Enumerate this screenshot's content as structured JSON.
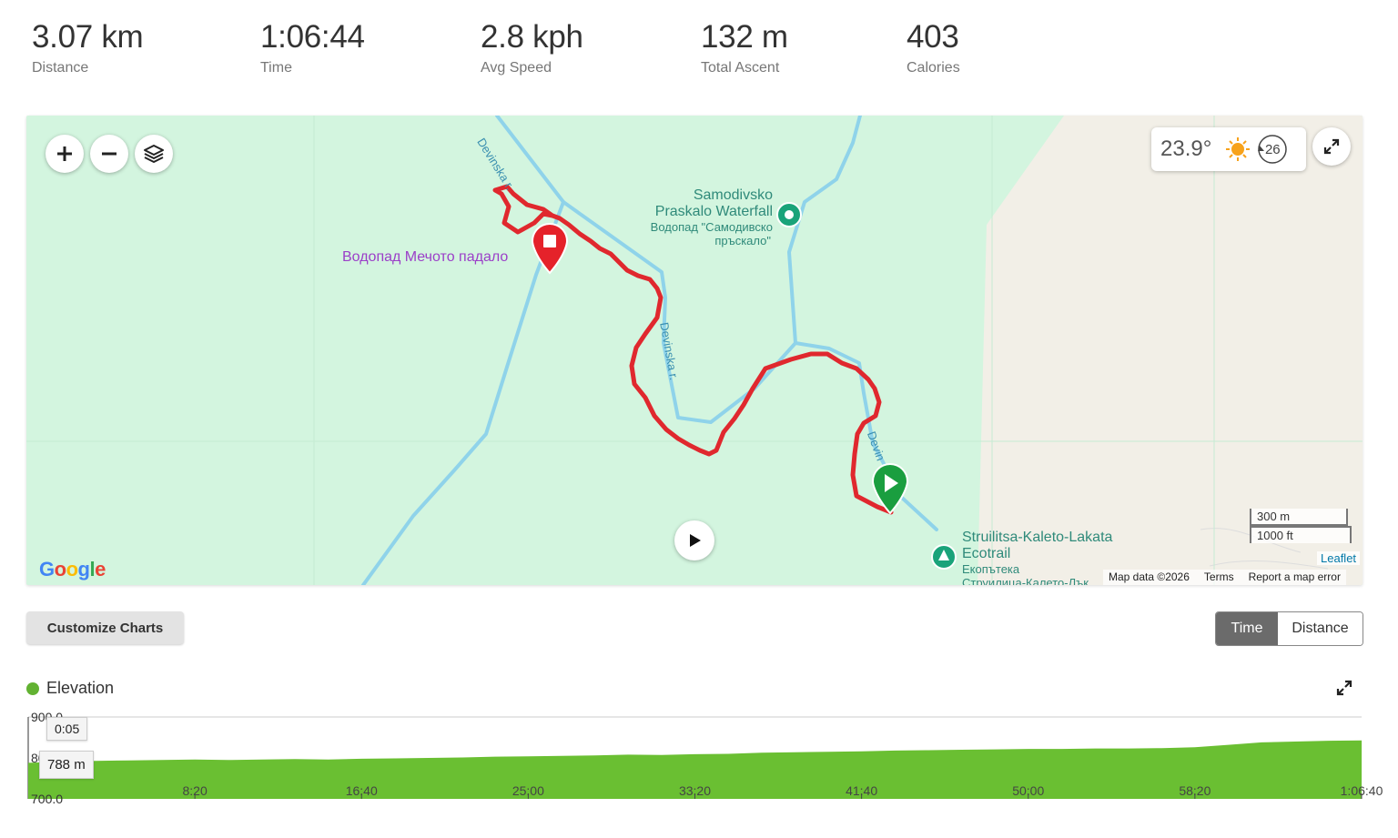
{
  "stats": [
    {
      "value": "3.07 km",
      "label": "Distance"
    },
    {
      "value": "1:06:44",
      "label": "Time"
    },
    {
      "value": "2.8 kph",
      "label": "Avg Speed"
    },
    {
      "value": "132 m",
      "label": "Total Ascent"
    },
    {
      "value": "403",
      "label": "Calories"
    }
  ],
  "map": {
    "weather": {
      "temperature": "23.9°",
      "icon": "sun-icon",
      "wind_speed": "26",
      "wind_icon": "wind-direction-icon"
    },
    "labels": {
      "river_1": "Devinska r.",
      "river_2": "Devinska r.",
      "river_3": "Devin",
      "waterfall_name_1": "Samodivsko",
      "waterfall_name_2": "Praskalo Waterfall",
      "waterfall_local_1": "Водопад \"Самодивско",
      "waterfall_local_2": "пръскало\"",
      "end_poi": "Водопад Мечото падало",
      "trail_name_1": "Struilitsa-Kaleto-Lakata",
      "trail_name_2": "Ecotrail",
      "trail_local_1": "Екопътека",
      "trail_local_2": "Струилица-Калето-Лък"
    },
    "scale": {
      "metric": "300 m",
      "imperial": "1000 ft"
    },
    "attribution": {
      "leaflet": "Leaflet",
      "map_data": "Map data ©2026",
      "terms": "Terms",
      "report": "Report a map error"
    },
    "google": "Google",
    "colors": {
      "route": "#e0282e",
      "start": "#1a9e3f",
      "end": "#e5222a",
      "water": "#8fd3ea",
      "land": "#d3f5df",
      "terrain": "#f2efe7"
    }
  },
  "controls": {
    "customize": "Customize Charts",
    "toggle": {
      "time": "Time",
      "distance": "Distance"
    }
  },
  "chart_title": "Elevation",
  "tooltip": {
    "time": "0:05",
    "elevation": "788 m"
  },
  "chart_data": {
    "type": "area",
    "title": "Elevation",
    "series": [
      {
        "name": "Elevation",
        "color": "#6abf32"
      }
    ],
    "x": [
      "0:00",
      "1:40",
      "3:20",
      "5:00",
      "6:40",
      "8:20",
      "10:00",
      "11:40",
      "13:20",
      "15:00",
      "16:40",
      "18:20",
      "20:00",
      "21:40",
      "23:20",
      "25:00",
      "26:40",
      "28:20",
      "30:00",
      "31:40",
      "33:20",
      "35:00",
      "36:40",
      "38:20",
      "40:00",
      "41:40",
      "43:20",
      "45:00",
      "46:40",
      "48:20",
      "50:00",
      "51:40",
      "53:20",
      "55:00",
      "56:40",
      "58:20",
      "60:00",
      "61:40",
      "63:20",
      "65:00",
      "66:40"
    ],
    "x_minutes": [
      0,
      1.67,
      3.33,
      5,
      6.67,
      8.33,
      10,
      11.67,
      13.33,
      15,
      16.67,
      18.33,
      20,
      21.67,
      23.33,
      25,
      26.67,
      28.33,
      30,
      31.67,
      33.33,
      35,
      36.67,
      38.33,
      40,
      41.67,
      43.33,
      45,
      46.67,
      48.33,
      50,
      51.67,
      53.33,
      55,
      56.67,
      58.33,
      60,
      61.67,
      63.33,
      65,
      66.67
    ],
    "elevation_m": [
      788,
      791,
      793,
      794,
      795,
      796,
      795,
      796,
      797,
      796,
      798,
      799,
      800,
      801,
      803,
      804,
      805,
      806,
      808,
      807,
      809,
      810,
      813,
      814,
      815,
      816,
      818,
      819,
      820,
      821,
      822,
      822,
      823,
      823,
      824,
      826,
      832,
      838,
      840,
      842,
      843
    ],
    "xticks": [
      "8:20",
      "16:40",
      "25:00",
      "33:20",
      "41:40",
      "50:00",
      "58:20",
      "1:06:40"
    ],
    "xtick_minutes": [
      8.333,
      16.667,
      25,
      33.333,
      41.667,
      50,
      58.333,
      66.667
    ],
    "yticks": [
      "900.0",
      "800.0",
      "700.0"
    ],
    "ylim": [
      700,
      900
    ],
    "xlim_minutes": [
      0,
      66.667
    ]
  }
}
